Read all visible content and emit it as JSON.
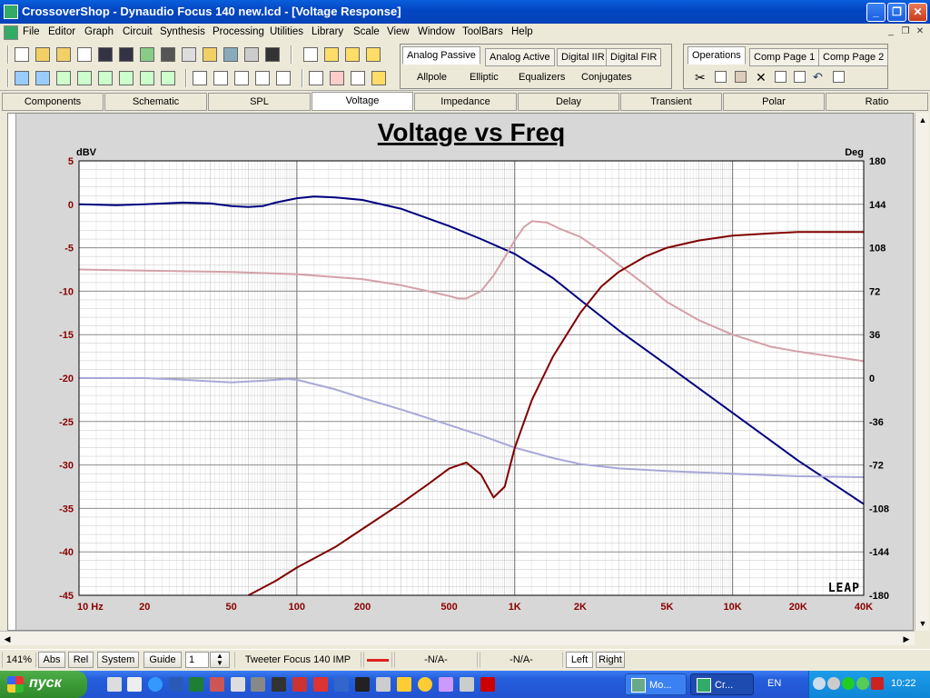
{
  "window": {
    "title": "CrossoverShop - Dynaudio Focus 140 new.lcd - [Voltage Response]"
  },
  "menu": [
    "File",
    "Editor",
    "Graph",
    "Circuit",
    "Synthesis",
    "Processing",
    "Utilities",
    "Library",
    "Scale",
    "View",
    "Window",
    "ToolBars",
    "Help"
  ],
  "synth_tabs": {
    "row1": [
      "Analog Passive",
      "Analog Active",
      "Digital IIR",
      "Digital FIR"
    ],
    "row2": [
      "Allpole",
      "Elliptic",
      "Equalizers",
      "Conjugates"
    ]
  },
  "ops_tabs": [
    "Operations",
    "Comp Page 1",
    "Comp Page 2"
  ],
  "view_tabs": [
    "Components",
    "Schematic",
    "SPL",
    "Voltage",
    "Impedance",
    "Delay",
    "Transient",
    "Polar",
    "Ratio"
  ],
  "active_view": "Voltage",
  "status": {
    "zoom": "141%",
    "abs": "Abs",
    "rel": "Rel",
    "system": "System",
    "guide": "Guide",
    "guide_value": "1",
    "curve_name": "Tweeter Focus 140 IMP",
    "val1": "-N/A-",
    "val2": "-N/A-",
    "left": "Left",
    "right": "Right"
  },
  "taskbar": {
    "start": "пуск",
    "task1": "Мо...",
    "task2": "Cr...",
    "lang": "EN",
    "clock": "10:22"
  },
  "colors": {
    "grid": "#808080",
    "axis_text": "#8b0000",
    "plot_bg": "#ffffff",
    "navy": "#000080",
    "maroon": "#800000",
    "pink": "#d4a0a8",
    "lavender": "#a8a8d8"
  },
  "chart_data": {
    "type": "line",
    "title": "Voltage vs Freq",
    "ylabel_left": "dBV",
    "ylabel_right": "Deg",
    "watermark": "LEAP",
    "x_scale": "log",
    "xlim": [
      10,
      40000
    ],
    "ylim_left": [
      -45,
      5
    ],
    "ylim_right": [
      -180,
      180
    ],
    "x_tick_labels": [
      {
        "v": 10,
        "t": "10 Hz"
      },
      {
        "v": 20,
        "t": "20"
      },
      {
        "v": 50,
        "t": "50"
      },
      {
        "v": 100,
        "t": "100"
      },
      {
        "v": 200,
        "t": "200"
      },
      {
        "v": 500,
        "t": "500"
      },
      {
        "v": 1000,
        "t": "1K"
      },
      {
        "v": 2000,
        "t": "2K"
      },
      {
        "v": 5000,
        "t": "5K"
      },
      {
        "v": 10000,
        "t": "10K"
      },
      {
        "v": 20000,
        "t": "20K"
      },
      {
        "v": 40000,
        "t": "40K"
      }
    ],
    "y_left_ticks": [
      5,
      0,
      -5,
      -10,
      -15,
      -20,
      -25,
      -30,
      -35,
      -40,
      -45
    ],
    "y_right_ticks": [
      180,
      144,
      108,
      72,
      36,
      0,
      -36,
      -72,
      -108,
      -144,
      -180
    ],
    "series": [
      {
        "axis": "left",
        "color": "navy",
        "x": [
          10,
          15,
          20,
          30,
          40,
          50,
          60,
          70,
          80,
          100,
          120,
          150,
          200,
          300,
          500,
          700,
          1000,
          1300,
          1500,
          2000,
          3000,
          5000,
          10000,
          20000,
          40000
        ],
        "y": [
          0,
          -0.1,
          0,
          0.2,
          0.1,
          -0.2,
          -0.3,
          -0.2,
          0.2,
          0.7,
          0.9,
          0.8,
          0.5,
          -0.5,
          -2.5,
          -4,
          -5.7,
          -7.5,
          -8.5,
          -11,
          -14.5,
          -18.5,
          -24,
          -29.5,
          -34.5
        ]
      },
      {
        "axis": "left",
        "color": "lavender",
        "x": [
          10,
          20,
          30,
          50,
          70,
          90,
          100,
          150,
          200,
          300,
          500,
          700,
          1000,
          1500,
          2000,
          3000,
          5000,
          10000,
          20000,
          40000
        ],
        "y": [
          -20,
          -20,
          -20.2,
          -20.5,
          -20.3,
          -20.1,
          -20.2,
          -21.3,
          -22.3,
          -23.6,
          -25.4,
          -26.6,
          -28,
          -29.2,
          -29.9,
          -30.4,
          -30.7,
          -31,
          -31.3,
          -31.4
        ]
      },
      {
        "axis": "right",
        "color": "pink",
        "x": [
          10,
          20,
          50,
          100,
          200,
          300,
          400,
          500,
          550,
          600,
          700,
          800,
          900,
          1000,
          1100,
          1200,
          1400,
          1600,
          2000,
          2500,
          3000,
          4000,
          5000,
          7000,
          10000,
          15000,
          20000,
          40000
        ],
        "y": [
          90,
          89,
          88,
          86,
          82,
          77,
          72,
          68,
          66,
          66,
          72,
          85,
          100,
          114,
          125,
          130,
          129,
          124,
          117,
          105,
          94,
          77,
          63,
          48,
          36,
          26,
          22,
          14
        ]
      },
      {
        "axis": "right",
        "color": "maroon",
        "x": [
          60,
          80,
          100,
          150,
          200,
          300,
          400,
          500,
          600,
          700,
          800,
          900,
          1000,
          1200,
          1500,
          2000,
          2500,
          3000,
          4000,
          5000,
          7000,
          10000,
          15000,
          20000,
          30000,
          40000
        ],
        "y": [
          -180,
          -168,
          -157,
          -140,
          -125,
          -104,
          -88,
          -75,
          -70,
          -80,
          -99,
          -90,
          -58,
          -18,
          18,
          54,
          76,
          88,
          101,
          108,
          114,
          118,
          120,
          121,
          121,
          121
        ]
      }
    ]
  }
}
